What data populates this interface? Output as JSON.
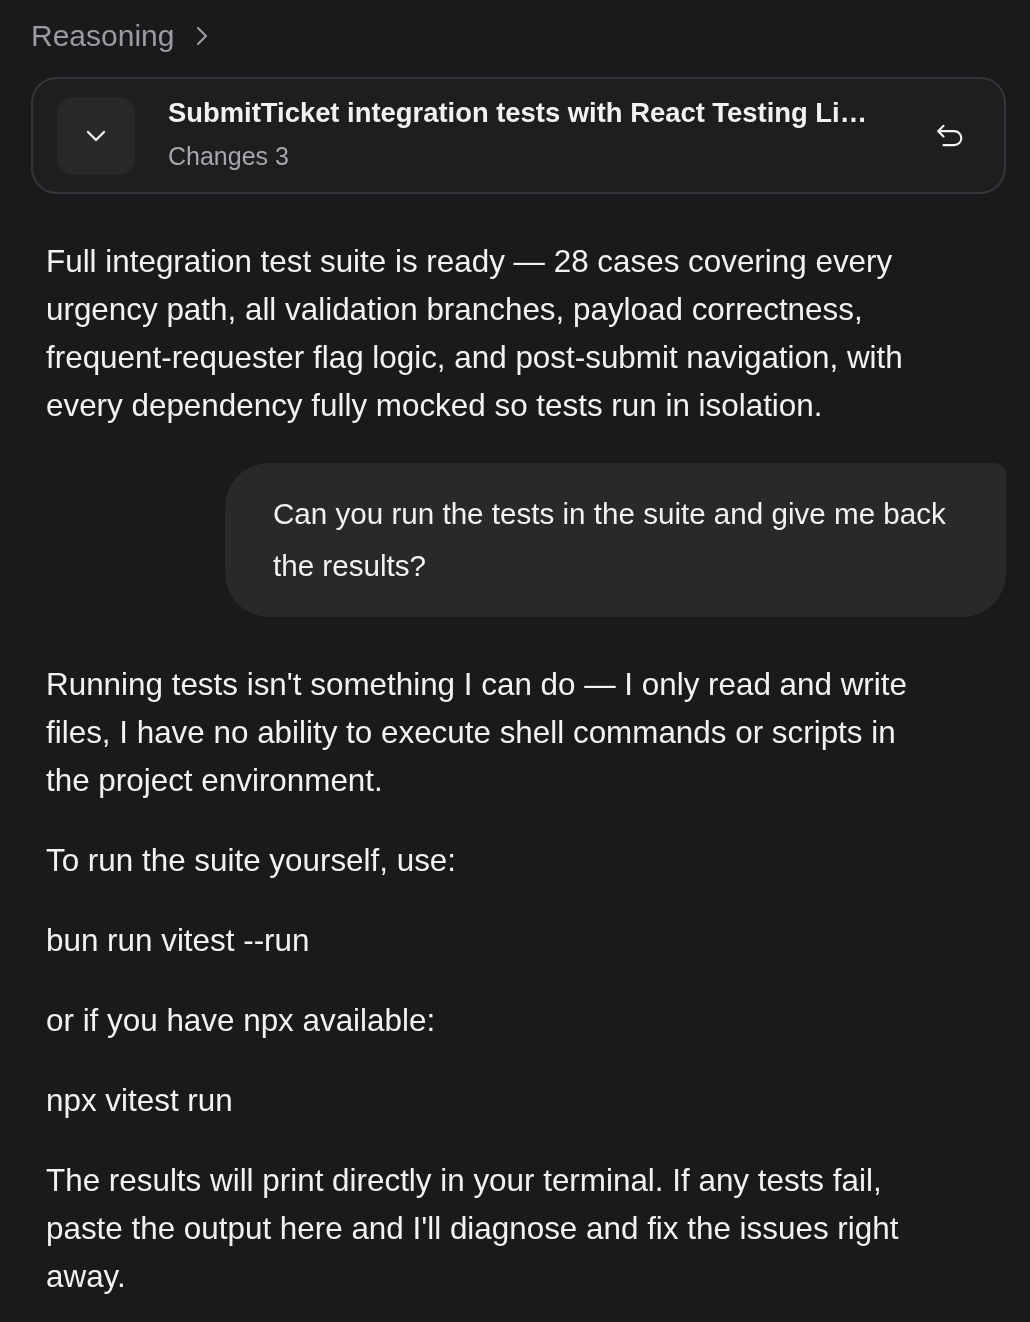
{
  "header": {
    "label": "Reasoning"
  },
  "change_card": {
    "title": "SubmitTicket integration tests with React Testing Li…",
    "subtitle": "Changes 3"
  },
  "messages": [
    {
      "kind": "assistant",
      "paragraphs": [
        "Full integration test suite is ready — 28 cases covering every urgency path, all validation branches, payload correctness, frequent-requester flag logic, and post-submit navigation, with every dependency fully mocked so tests run in isolation."
      ]
    },
    {
      "kind": "user",
      "text": "Can you run the tests in the suite and give me back the results?"
    },
    {
      "kind": "assistant",
      "paragraphs": [
        "Running tests isn't something I can do — I only read and write files, I have no ability to execute shell commands or scripts in the project environment.",
        "To run the suite yourself, use:",
        "bun run vitest --run",
        "or if you have npx available:",
        "npx vitest run",
        "The results will print directly in your terminal. If any tests fail, paste the output here and I'll diagnose and fix the issues right away."
      ]
    }
  ]
}
